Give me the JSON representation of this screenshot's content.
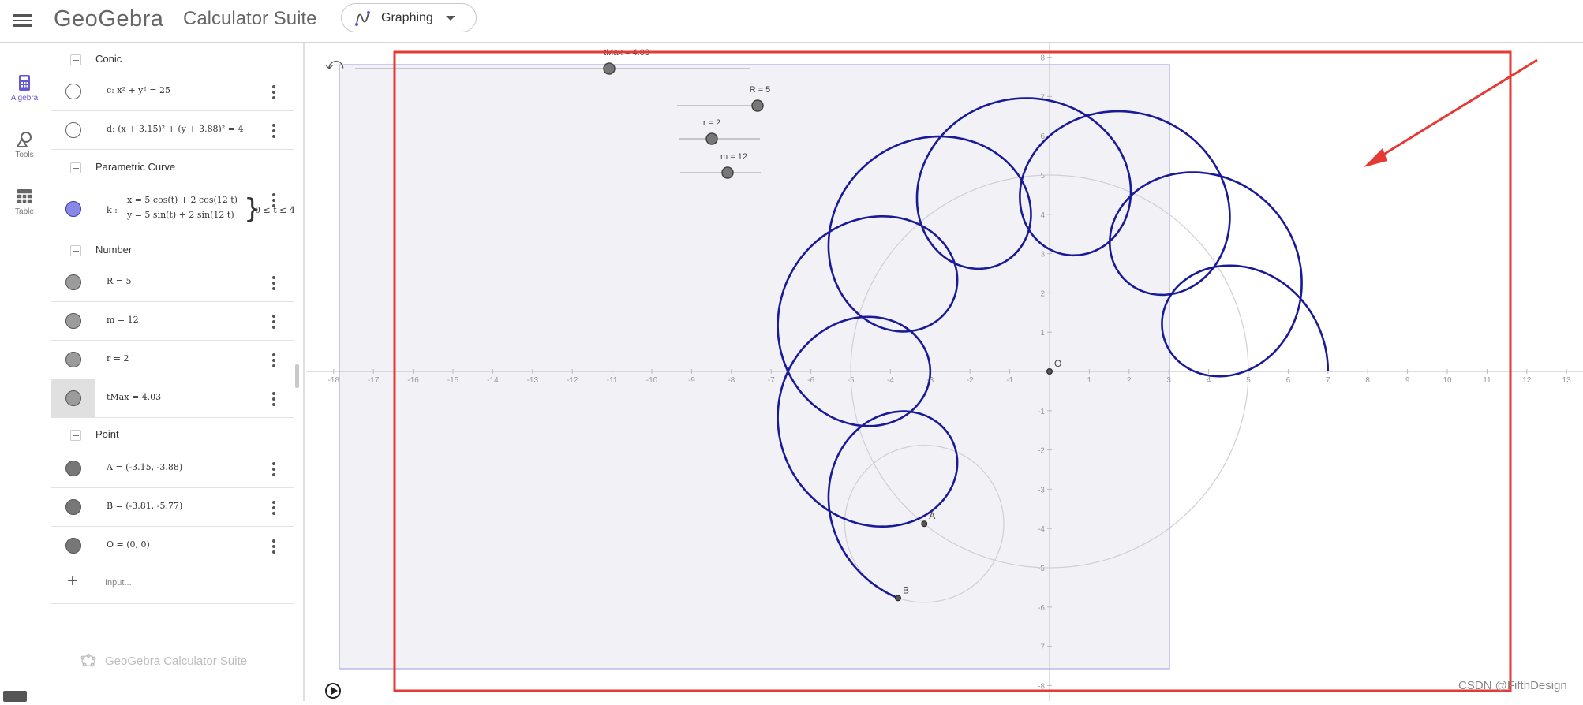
{
  "header": {
    "logo": "GeoGebra",
    "suite_title": "Calculator Suite",
    "app_picker_label": "Graphing"
  },
  "rail": [
    {
      "label": "Algebra",
      "icon": "calculator-icon",
      "active": true
    },
    {
      "label": "Tools",
      "icon": "shapes-icon",
      "active": false
    },
    {
      "label": "Table",
      "icon": "table-icon",
      "active": false
    }
  ],
  "algebra": {
    "sections": {
      "conic": "Conic",
      "parametric": "Parametric Curve",
      "number": "Number",
      "point": "Point"
    },
    "conic_rows": [
      {
        "expr": "c: x² + y² = 25"
      },
      {
        "expr": "d: (x + 3.15)² + (y + 3.88)² = 4"
      }
    ],
    "parametric": {
      "name": "k :",
      "line1": "x = 5 cos(t) + 2 cos(12 t)",
      "line2": "y = 5 sin(t) + 2 sin(12 t)",
      "domain": "0 ≤ t ≤ 4"
    },
    "number_rows": [
      {
        "expr": "R = 5"
      },
      {
        "expr": "m = 12"
      },
      {
        "expr": "r = 2"
      },
      {
        "expr": "tMax = 4.03"
      }
    ],
    "point_rows": [
      {
        "expr": "A = (-3.15, -3.88)"
      },
      {
        "expr": "B = (-3.81, -5.77)"
      },
      {
        "expr": "O = (0, 0)"
      }
    ],
    "input_placeholder": "Input...",
    "footer": "GeoGebra Calculator Suite"
  },
  "graph": {
    "sliders": [
      {
        "label": "tMax = 4.03",
        "value": 4.03
      },
      {
        "label": "R = 5",
        "value": 5
      },
      {
        "label": "r = 2",
        "value": 2
      },
      {
        "label": "m = 12",
        "value": 12
      }
    ],
    "x_ticks": [
      -18,
      -17,
      -16,
      -15,
      -14,
      -13,
      -12,
      -11,
      -10,
      -9,
      -8,
      -7,
      -6,
      -5,
      -4,
      -3,
      -2,
      -1,
      1,
      2,
      3,
      4,
      5,
      6,
      7,
      8,
      9,
      10,
      11,
      12,
      13
    ],
    "y_ticks": [
      -8,
      -7,
      -6,
      -5,
      -4,
      -3,
      -2,
      -1,
      1,
      2,
      3,
      4,
      5,
      6,
      7,
      8
    ],
    "curve": {
      "R": 5,
      "r": 2,
      "m": 12,
      "t_max": 4.03,
      "color": "#1a1a99"
    },
    "circle_c": {
      "cx": 0,
      "cy": 0,
      "radius": 5
    },
    "circle_d": {
      "cx": -3.15,
      "cy": -3.88,
      "radius": 2
    },
    "points": [
      {
        "label": "O",
        "x": 0,
        "y": 0
      },
      {
        "label": "A",
        "x": -3.15,
        "y": -3.88
      },
      {
        "label": "B",
        "x": -3.81,
        "y": -5.77
      }
    ],
    "annotation_color": "#e53935"
  },
  "watermark": "CSDN @FifthDesign"
}
